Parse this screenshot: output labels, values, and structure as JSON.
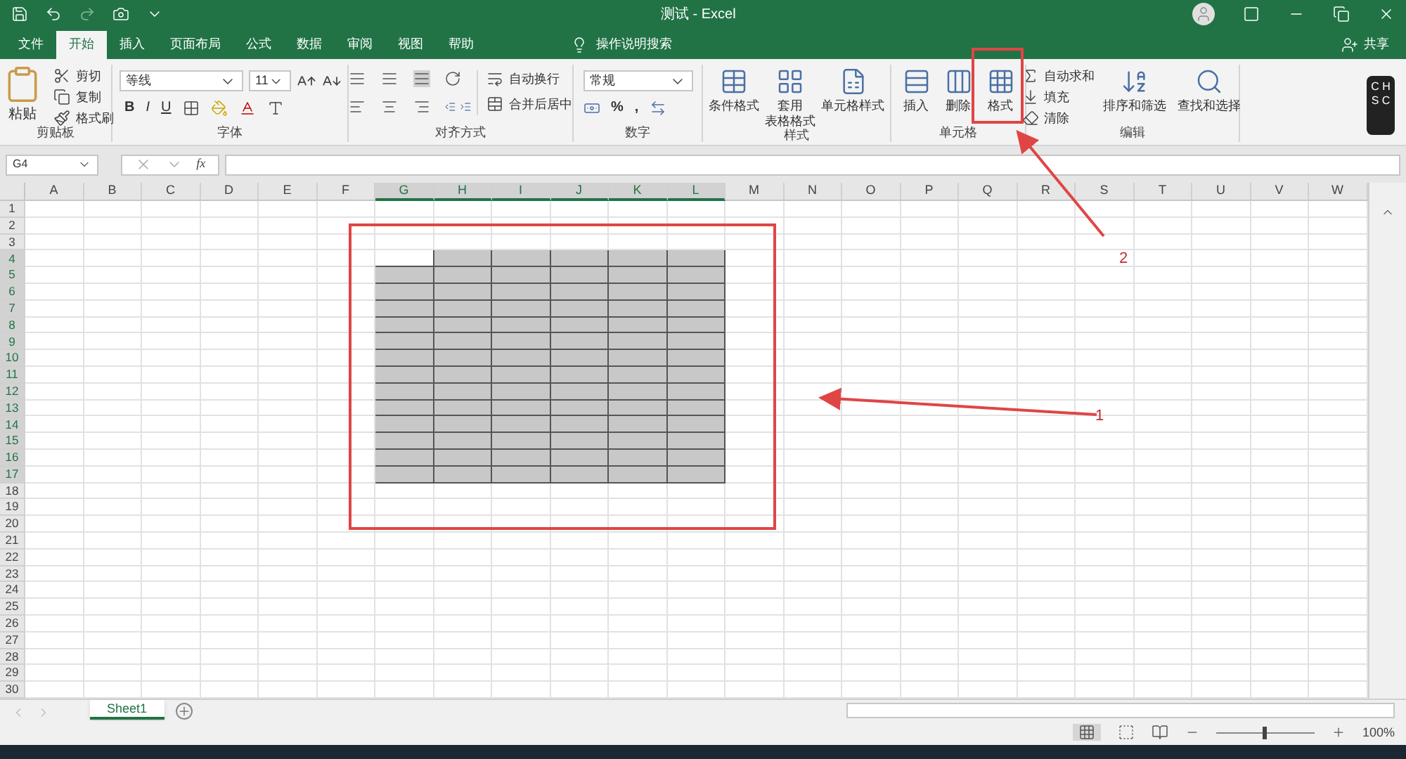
{
  "window": {
    "title": "测试 - Excel"
  },
  "tabs": [
    {
      "label": "文件",
      "selected": false
    },
    {
      "label": "开始",
      "selected": true
    },
    {
      "label": "插入",
      "selected": false
    },
    {
      "label": "页面布局",
      "selected": false
    },
    {
      "label": "公式",
      "selected": false
    },
    {
      "label": "数据",
      "selected": false
    },
    {
      "label": "审阅",
      "selected": false
    },
    {
      "label": "视图",
      "selected": false
    },
    {
      "label": "帮助",
      "selected": false
    }
  ],
  "tell_me": {
    "placeholder": "操作说明搜索"
  },
  "share": "共享",
  "ribbon": {
    "groups": [
      {
        "kind": "clipboard",
        "label": "剪贴板",
        "paste": "粘贴",
        "items": [
          "剪切",
          "复制",
          "格式刷"
        ]
      },
      {
        "kind": "font",
        "label": "字体",
        "font_name": "等线",
        "font_size": "11",
        "style_buttons": [
          "B",
          "I",
          "U"
        ]
      },
      {
        "kind": "alignment",
        "label": "对齐方式",
        "items": [
          "自动换行",
          "合并后居中"
        ]
      },
      {
        "kind": "number",
        "label": "数字",
        "format": "常规",
        "symbols": [
          "%",
          ","
        ]
      },
      {
        "kind": "styles",
        "label": "样式",
        "items": [
          {
            "lines": [
              "条件格式"
            ]
          },
          {
            "lines": [
              "套用",
              "表格格式"
            ]
          },
          {
            "lines": [
              "单元格样式"
            ]
          }
        ]
      },
      {
        "kind": "cells",
        "label": "单元格",
        "items": [
          {
            "lines": [
              "插入"
            ]
          },
          {
            "lines": [
              "删除"
            ]
          },
          {
            "lines": [
              "格式"
            ]
          }
        ]
      },
      {
        "kind": "editing",
        "label": "编辑",
        "small": [
          "自动求和",
          "填充",
          "清除"
        ],
        "large": [
          {
            "lines": [
              "排序和筛选"
            ]
          },
          {
            "lines": [
              "查找和选择"
            ]
          }
        ]
      }
    ]
  },
  "ime_badge": [
    "C H",
    "S C"
  ],
  "formula_bar": {
    "name_box": "G4",
    "fx": "fx"
  },
  "sheet": {
    "columns": [
      {
        "label": "A",
        "selected": false
      },
      {
        "label": "B",
        "selected": false
      },
      {
        "label": "C",
        "selected": false
      },
      {
        "label": "D",
        "selected": false
      },
      {
        "label": "E",
        "selected": false
      },
      {
        "label": "F",
        "selected": false
      },
      {
        "label": "G",
        "selected": true
      },
      {
        "label": "H",
        "selected": true
      },
      {
        "label": "I",
        "selected": true
      },
      {
        "label": "J",
        "selected": true
      },
      {
        "label": "K",
        "selected": true
      },
      {
        "label": "L",
        "selected": true
      },
      {
        "label": "M",
        "selected": false
      },
      {
        "label": "N",
        "selected": false
      },
      {
        "label": "O",
        "selected": false
      },
      {
        "label": "P",
        "selected": false
      },
      {
        "label": "Q",
        "selected": false
      },
      {
        "label": "R",
        "selected": false
      },
      {
        "label": "S",
        "selected": false
      },
      {
        "label": "T",
        "selected": false
      },
      {
        "label": "U",
        "selected": false
      },
      {
        "label": "V",
        "selected": false
      },
      {
        "label": "W",
        "selected": false
      }
    ],
    "rows": [
      {
        "label": "1",
        "selected": false
      },
      {
        "label": "2",
        "selected": false
      },
      {
        "label": "3",
        "selected": false
      },
      {
        "label": "4",
        "selected": true
      },
      {
        "label": "5",
        "selected": true
      },
      {
        "label": "6",
        "selected": true
      },
      {
        "label": "7",
        "selected": true
      },
      {
        "label": "8",
        "selected": true
      },
      {
        "label": "9",
        "selected": true
      },
      {
        "label": "10",
        "selected": true
      },
      {
        "label": "11",
        "selected": true
      },
      {
        "label": "12",
        "selected": true
      },
      {
        "label": "13",
        "selected": true
      },
      {
        "label": "14",
        "selected": true
      },
      {
        "label": "15",
        "selected": true
      },
      {
        "label": "16",
        "selected": true
      },
      {
        "label": "17",
        "selected": true
      },
      {
        "label": "18",
        "selected": false
      },
      {
        "label": "19",
        "selected": false
      },
      {
        "label": "20",
        "selected": false
      },
      {
        "label": "21",
        "selected": false
      },
      {
        "label": "22",
        "selected": false
      },
      {
        "label": "23",
        "selected": false
      },
      {
        "label": "24",
        "selected": false
      },
      {
        "label": "25",
        "selected": false
      },
      {
        "label": "26",
        "selected": false
      },
      {
        "label": "27",
        "selected": false
      },
      {
        "label": "28",
        "selected": false
      },
      {
        "label": "29",
        "selected": false
      },
      {
        "label": "30",
        "selected": false
      }
    ]
  },
  "sheet_tabs": [
    {
      "label": "Sheet1",
      "selected": true
    }
  ],
  "status_bar": {
    "zoom": "100%",
    "zoom_slider": {
      "level": 0.5
    }
  },
  "annotations": [
    {
      "label": "1"
    },
    {
      "label": "2"
    }
  ]
}
